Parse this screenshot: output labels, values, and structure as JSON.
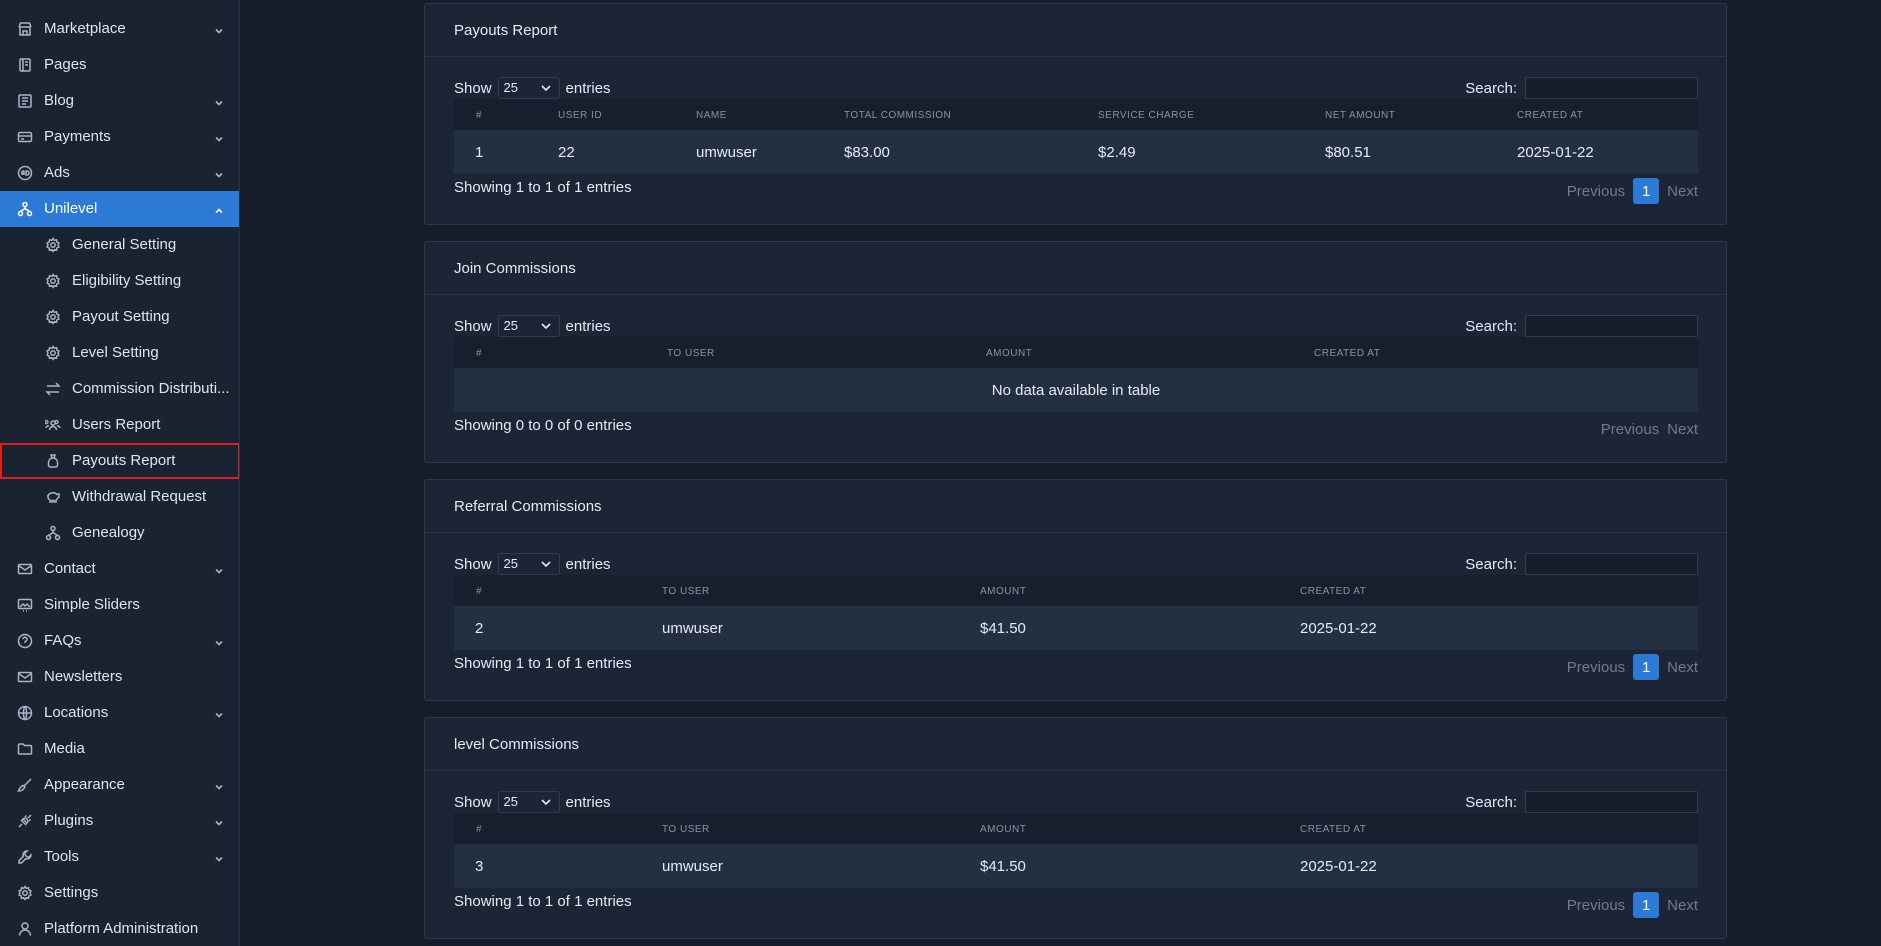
{
  "sidebar": {
    "items": [
      {
        "name": "marketplace",
        "label": "Marketplace",
        "icon": "store-icon",
        "chevron": true
      },
      {
        "name": "pages",
        "label": "Pages",
        "icon": "page-icon",
        "chevron": false
      },
      {
        "name": "blog",
        "label": "Blog",
        "icon": "article-icon",
        "chevron": true
      },
      {
        "name": "payments",
        "label": "Payments",
        "icon": "credit-card-icon",
        "chevron": true
      },
      {
        "name": "ads",
        "label": "Ads",
        "icon": "ad-icon",
        "chevron": true
      },
      {
        "name": "unilevel",
        "label": "Unilevel",
        "icon": "hierarchy-icon",
        "chevron": true
      },
      {
        "name": "general-setting",
        "label": "General Setting",
        "icon": "gear-icon",
        "chevron": false
      },
      {
        "name": "eligibility-setting",
        "label": "Eligibility Setting",
        "icon": "gear-icon",
        "chevron": false
      },
      {
        "name": "payout-setting",
        "label": "Payout Setting",
        "icon": "gear-icon",
        "chevron": false
      },
      {
        "name": "level-setting",
        "label": "Level Setting",
        "icon": "gear-icon",
        "chevron": false
      },
      {
        "name": "commission-distribution",
        "label": "Commission Distributi...",
        "icon": "arrows-exchange-icon",
        "chevron": false
      },
      {
        "name": "users-report",
        "label": "Users Report",
        "icon": "users-icon",
        "chevron": false
      },
      {
        "name": "payouts-report",
        "label": "Payouts Report",
        "icon": "money-bag-icon",
        "chevron": false
      },
      {
        "name": "withdrawal-request",
        "label": "Withdrawal Request",
        "icon": "piggy-bank-icon",
        "chevron": false
      },
      {
        "name": "genealogy",
        "label": "Genealogy",
        "icon": "hierarchy-icon",
        "chevron": false
      },
      {
        "name": "contact",
        "label": "Contact",
        "icon": "mail-icon",
        "chevron": true
      },
      {
        "name": "simple-sliders",
        "label": "Simple Sliders",
        "icon": "slideshow-icon",
        "chevron": false
      },
      {
        "name": "faqs",
        "label": "FAQs",
        "icon": "help-circle-icon",
        "chevron": true
      },
      {
        "name": "newsletters",
        "label": "Newsletters",
        "icon": "mail-icon",
        "chevron": false
      },
      {
        "name": "locations",
        "label": "Locations",
        "icon": "globe-icon",
        "chevron": true
      },
      {
        "name": "media",
        "label": "Media",
        "icon": "folder-icon",
        "chevron": false
      },
      {
        "name": "appearance",
        "label": "Appearance",
        "icon": "brush-icon",
        "chevron": true
      },
      {
        "name": "plugins",
        "label": "Plugins",
        "icon": "plug-icon",
        "chevron": true
      },
      {
        "name": "tools",
        "label": "Tools",
        "icon": "wrench-icon",
        "chevron": true
      },
      {
        "name": "settings",
        "label": "Settings",
        "icon": "gear-icon",
        "chevron": false
      },
      {
        "name": "platform-administration",
        "label": "Platform Administration",
        "icon": "user-icon",
        "chevron": false
      }
    ]
  },
  "common": {
    "show_label": "Show",
    "entries_label": "entries",
    "page_length": "25",
    "search_label": "Search:",
    "previous_label": "Previous",
    "next_label": "Next",
    "current_page": "1"
  },
  "payouts_report": {
    "title": "Payouts Report",
    "columns": [
      "#",
      "USER ID",
      "NAME",
      "TOTAL COMMISSION",
      "SERVICE CHARGE",
      "NET AMOUNT",
      "CREATED AT"
    ],
    "rows": [
      [
        "1",
        "22",
        "umwuser",
        "$83.00",
        "$2.49",
        "$80.51",
        "2025-01-22"
      ]
    ],
    "info": "Showing 1 to 1 of 1 entries"
  },
  "join_commissions": {
    "title": "Join Commissions",
    "columns": [
      "#",
      "TO USER",
      "AMOUNT",
      "CREATED AT"
    ],
    "empty_message": "No data available in table",
    "info": "Showing 0 to 0 of 0 entries"
  },
  "referral_commissions": {
    "title": "Referral Commissions",
    "columns": [
      "#",
      "TO USER",
      "AMOUNT",
      "CREATED AT"
    ],
    "rows": [
      [
        "2",
        "umwuser",
        "$41.50",
        "2025-01-22"
      ]
    ],
    "info": "Showing 1 to 1 of 1 entries"
  },
  "level_commissions": {
    "title": "level Commissions",
    "columns": [
      "#",
      "TO USER",
      "AMOUNT",
      "CREATED AT"
    ],
    "rows": [
      [
        "3",
        "umwuser",
        "$41.50",
        "2025-01-22"
      ]
    ],
    "info": "Showing 1 to 1 of 1 entries"
  },
  "colors": {
    "accent": "#2d7ad6",
    "highlight_border": "#e0201c",
    "background": "#151d2a",
    "card": "#1b2535"
  }
}
